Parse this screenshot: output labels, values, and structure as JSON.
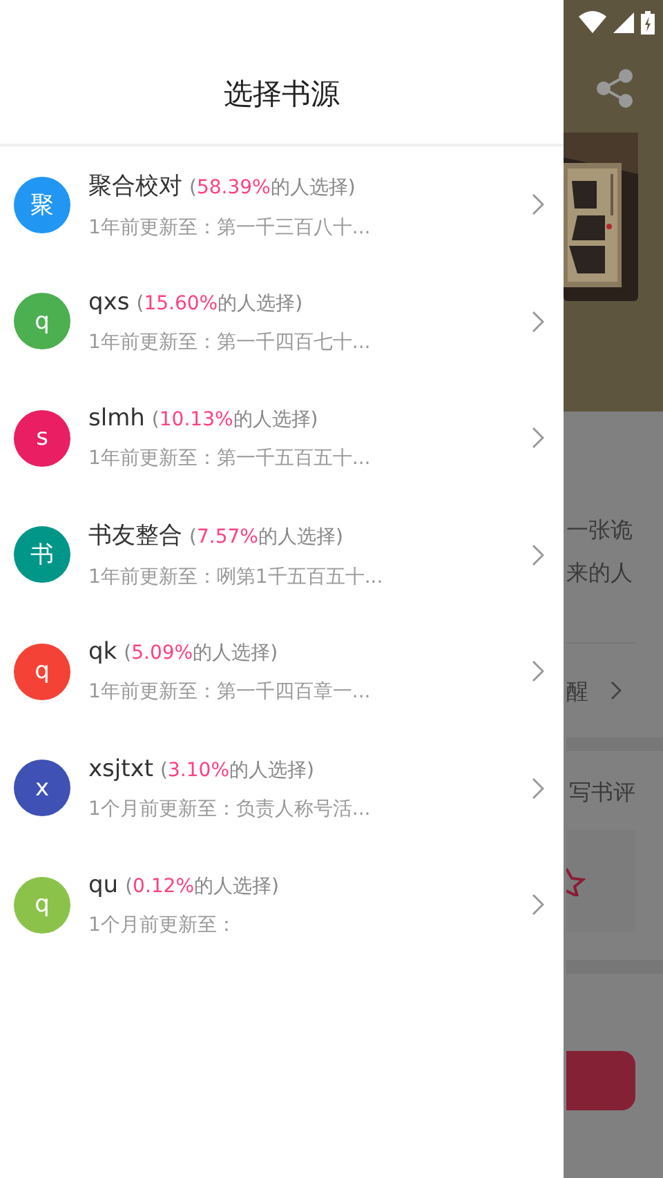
{
  "drawer": {
    "title": "选择书源",
    "sources": [
      {
        "avatar": "聚",
        "color": "#2196f3",
        "name": "聚合校对",
        "share_before": "(",
        "percent": "58.39%",
        "share_after": "的人选择)",
        "update": "1年前更新至：第一千三百八十..."
      },
      {
        "avatar": "q",
        "color": "#4caf50",
        "name": "qxs",
        "share_before": "(",
        "percent": "15.60%",
        "share_after": "的人选择)",
        "update": "1年前更新至：第一千四百七十..."
      },
      {
        "avatar": "s",
        "color": "#e91e63",
        "name": "slmh",
        "share_before": "(",
        "percent": "10.13%",
        "share_after": "的人选择)",
        "update": "1年前更新至：第一千五百五十..."
      },
      {
        "avatar": "书",
        "color": "#009688",
        "name": "书友整合",
        "share_before": "(",
        "percent": "7.57%",
        "share_after": "的人选择)",
        "update": "1年前更新至：咧第1千五百五十..."
      },
      {
        "avatar": "q",
        "color": "#f44336",
        "name": "qk",
        "share_before": "(",
        "percent": "5.09%",
        "share_after": "的人选择)",
        "update": "1年前更新至：第一千四百章一..."
      },
      {
        "avatar": "x",
        "color": "#3f51b5",
        "name": "xsjtxt",
        "share_before": "(",
        "percent": "3.10%",
        "share_after": "的人选择)",
        "update": "1个月前更新至：负责人称号活..."
      },
      {
        "avatar": "q",
        "color": "#8bc34a",
        "name": "qu",
        "share_before": "(",
        "percent": "0.12%",
        "share_after": "的人选择)",
        "update": "1个月前更新至："
      }
    ]
  },
  "page_behind": {
    "intro_lines": [
      "一张诡",
      "来的人"
    ],
    "reminder": "醒",
    "review": "写书评"
  }
}
